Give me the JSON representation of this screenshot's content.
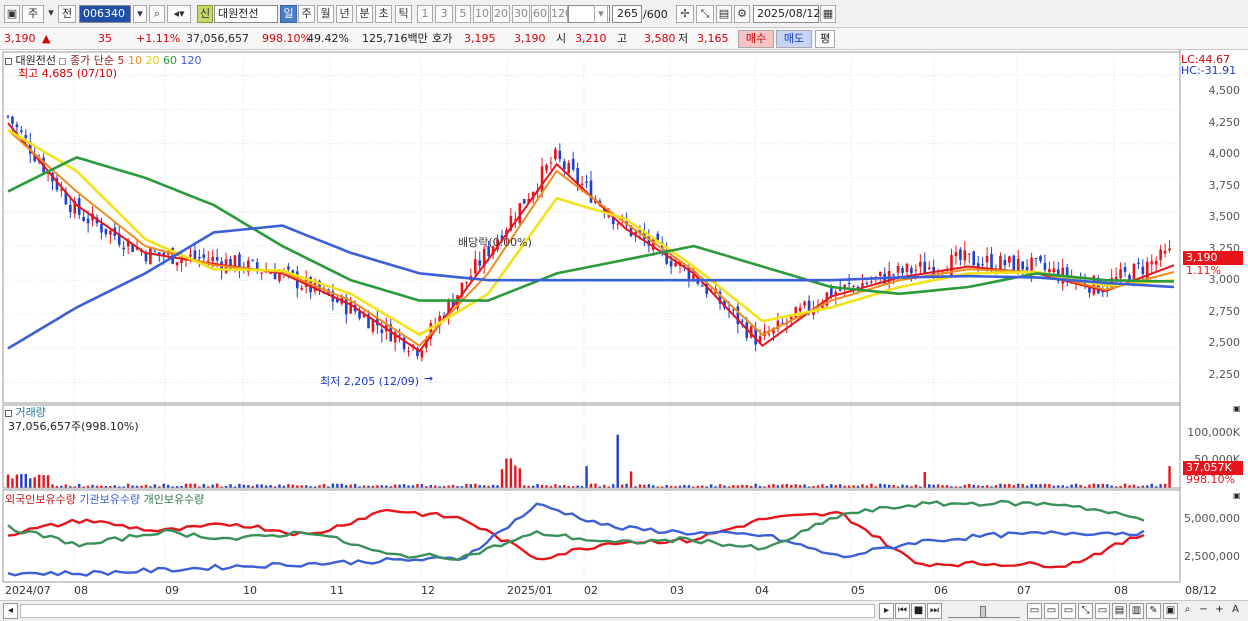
{
  "toolbar": {
    "market_tab1": "주",
    "market_tab2": "전",
    "stock_code": "006340",
    "stock_badge": "신",
    "stock_name": "대원전선",
    "periods": [
      "일",
      "주",
      "월",
      "년",
      "분",
      "초",
      "틱"
    ],
    "selected_period": "일",
    "intervals": [
      "1",
      "3",
      "5",
      "10",
      "20",
      "30",
      "60",
      "120"
    ],
    "count_value": "265",
    "count_total": "/600",
    "date_value": "2025/08/12"
  },
  "infobar": {
    "price": "3,190",
    "change_arrow": "▲",
    "change": "35",
    "change_pct": "+1.11%",
    "volume": "37,056,657",
    "volume_pct": "998.10%",
    "turnover_pct": "49.42%",
    "amount": "125,716백만",
    "ask_label": "호가",
    "ask1": "3,195",
    "ask2": "3,190",
    "open_label": "시",
    "open": "3,210",
    "high_label": "고",
    "high": "3,580",
    "low_label": "저",
    "low": "3,165",
    "buy_label": "매수",
    "sell_label": "매도",
    "eval_label": "평"
  },
  "price_panel": {
    "stock_name": "대원전선",
    "ma_label": "종가 단순",
    "ma_periods": [
      "5",
      "10",
      "20",
      "60",
      "120"
    ],
    "high_note": "최고 4,685 (07/10)",
    "low_note": "최저 2,205 (12/09)",
    "dividend_note": "배당락(0.00%)",
    "lc_label": "LC:44.67",
    "hc_label": "HC:-31.91",
    "current_price_tag": "3,190",
    "current_pct_tag": "1.11%",
    "y_ticks": [
      "4,500",
      "4,250",
      "4,000",
      "3,750",
      "3,500",
      "3,250",
      "3,000",
      "2,750",
      "2,500",
      "2,250"
    ]
  },
  "volume_panel": {
    "title": "거래량",
    "value_text": "37,056,657주(998.10%)",
    "y_ticks": [
      "100,000K",
      "50,000K"
    ],
    "current_tag": "37,057K",
    "current_pct": "998.10%"
  },
  "holding_panel": {
    "legend": [
      "외국인보유수량",
      "기관보유수량",
      "개인보유수량"
    ],
    "y_ticks": [
      "5,000,000",
      "2,500,000"
    ]
  },
  "x_axis": [
    "2024/07",
    "08",
    "09",
    "10",
    "11",
    "12",
    "2025/01",
    "02",
    "03",
    "04",
    "05",
    "06",
    "07",
    "08",
    "08/12"
  ],
  "colors": {
    "up": "#e8141c",
    "down": "#1f3fd1",
    "ma5": "#e8141c",
    "ma10": "#f08c1e",
    "ma20": "#f2e21a",
    "ma60": "#2a9a3a",
    "ma120": "#3b5fd6",
    "foreign": "#e8141c",
    "institution": "#3a5fd6",
    "individual": "#3a8f5a"
  },
  "chart_data": {
    "type": "candlestick",
    "x": [
      "2024/07",
      "08",
      "09",
      "10",
      "11",
      "12",
      "2025/01",
      "02",
      "03",
      "04",
      "05",
      "06",
      "07",
      "08"
    ],
    "price_ylim": [
      2100,
      4650
    ],
    "close_series": [
      4200,
      3500,
      3200,
      3150,
      3050,
      2800,
      2500,
      3200,
      3900,
      3400,
      3050,
      2550,
      2900,
      3050,
      3150,
      3100,
      2950,
      3190
    ],
    "ma_series": [
      {
        "name": "5",
        "values": [
          4150,
          3550,
          3200,
          3120,
          3050,
          2820,
          2480,
          3150,
          3850,
          3380,
          3050,
          2520,
          2880,
          3020,
          3100,
          3050,
          2920,
          3110
        ]
      },
      {
        "name": "10",
        "values": [
          4100,
          3650,
          3250,
          3110,
          3060,
          2850,
          2520,
          3050,
          3800,
          3420,
          3070,
          2600,
          2850,
          3000,
          3080,
          3060,
          2930,
          3060
        ]
      },
      {
        "name": "20",
        "values": [
          4100,
          3800,
          3300,
          3080,
          3070,
          2900,
          2600,
          2900,
          3600,
          3450,
          3100,
          2700,
          2800,
          2950,
          3050,
          3060,
          2960,
          3000
        ]
      },
      {
        "name": "60",
        "values": [
          3650,
          3900,
          3750,
          3550,
          3250,
          3000,
          2850,
          2850,
          3050,
          3150,
          3250,
          3100,
          2950,
          2900,
          2950,
          3050,
          3000,
          2990
        ]
      },
      {
        "name": "120",
        "values": [
          2500,
          2800,
          3050,
          3350,
          3400,
          3200,
          3050,
          3000,
          3000,
          3000,
          3000,
          3000,
          3000,
          3020,
          3030,
          3020,
          2980,
          2950
        ]
      }
    ],
    "volume_ylim": [
      0,
      120000
    ],
    "volume_unit": "K",
    "volume_last": 37057,
    "holding_ylim": [
      0,
      6500000
    ],
    "holding_series": [
      {
        "name": "외국인보유수량",
        "values": [
          3400000,
          4500000,
          3600000,
          4200000,
          3300000,
          5300000,
          4600000,
          1500000,
          2800000,
          2900000,
          4600000,
          5000000,
          1100000,
          1100000,
          1000000,
          3400000
        ]
      },
      {
        "name": "기관보유수량",
        "values": [
          400000,
          350000,
          600000,
          900000,
          1100000,
          1350000,
          1500000,
          5700000,
          3900000,
          3500000,
          3300000,
          1600000,
          2800000,
          3300000,
          3500000,
          3500000
        ]
      },
      {
        "name": "개인보유수량",
        "values": [
          3900000,
          2500000,
          3600000,
          3000000,
          3600000,
          1800000,
          1600000,
          3500000,
          2700000,
          3000000,
          2200000,
          4900000,
          5700000,
          5800000,
          5700000,
          4500000
        ]
      }
    ]
  }
}
